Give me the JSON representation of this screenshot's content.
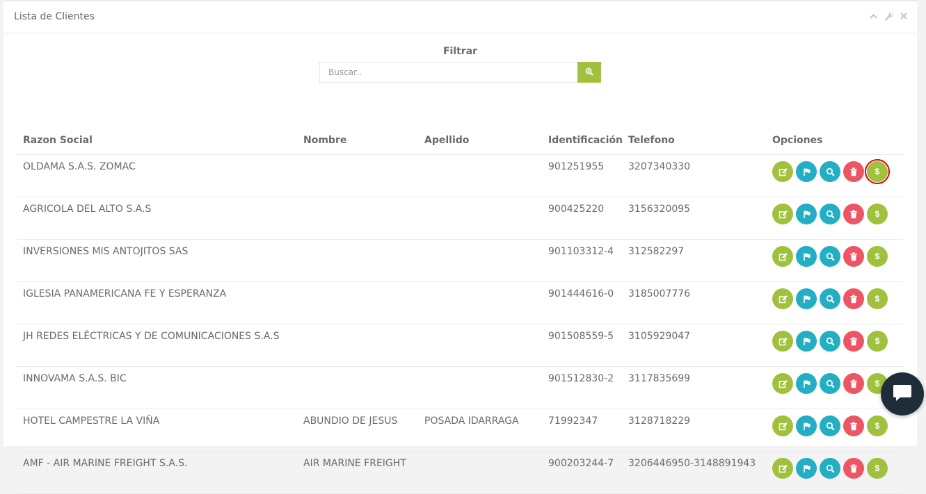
{
  "panel": {
    "title": "Lista de Clientes",
    "tools": [
      "chevron-up-icon",
      "wrench-icon",
      "close-icon"
    ]
  },
  "filter": {
    "label": "Filtrar",
    "placeholder": "Buscar..",
    "value": ""
  },
  "table": {
    "headers": [
      "Razon Social",
      "Nombre",
      "Apellido",
      "Identificación",
      "Telefono",
      "Opciones"
    ],
    "rows": [
      {
        "razon": "OLDAMA S.A.S. ZOMAC",
        "nombre": "",
        "apellido": "",
        "id": "901251955",
        "tel": "3207340330"
      },
      {
        "razon": "AGRICOLA DEL ALTO S.A.S",
        "nombre": "",
        "apellido": "",
        "id": "900425220",
        "tel": "3156320095"
      },
      {
        "razon": "INVERSIONES MIS ANTOJITOS SAS",
        "nombre": "",
        "apellido": "",
        "id": "901103312-4",
        "tel": "312582297"
      },
      {
        "razon": "IGLESIA PANAMERICANA FE Y ESPERANZA",
        "nombre": "",
        "apellido": "",
        "id": "901444616-0",
        "tel": "3185007776"
      },
      {
        "razon": "JH REDES ELÉCTRICAS Y DE COMUNICACIONES S.A.S",
        "nombre": "",
        "apellido": "",
        "id": "901508559-5",
        "tel": "3105929047"
      },
      {
        "razon": "INNOVAMA S.A.S. BIC",
        "nombre": "",
        "apellido": "",
        "id": "901512830-2",
        "tel": "3117835699"
      },
      {
        "razon": "HOTEL CAMPESTRE LA VIÑA",
        "nombre": "ABUNDIO DE JESUS",
        "apellido": "POSADA IDARRAGA",
        "id": "71992347",
        "tel": "3128718229"
      },
      {
        "razon": "AMF - AIR MARINE FREIGHT S.A.S.",
        "nombre": "AIR MARINE FREIGHT",
        "apellido": "",
        "id": "900203244-7",
        "tel": "3206446950-3148891943"
      }
    ],
    "option_icons": [
      "edit-icon",
      "flag-icon",
      "search-icon",
      "trash-icon",
      "dollar-icon"
    ],
    "pay_symbol": "$"
  },
  "colors": {
    "green": "#a0c13d",
    "teal": "#23aec4",
    "red": "#ed5565",
    "chat": "#1f2c3a"
  }
}
